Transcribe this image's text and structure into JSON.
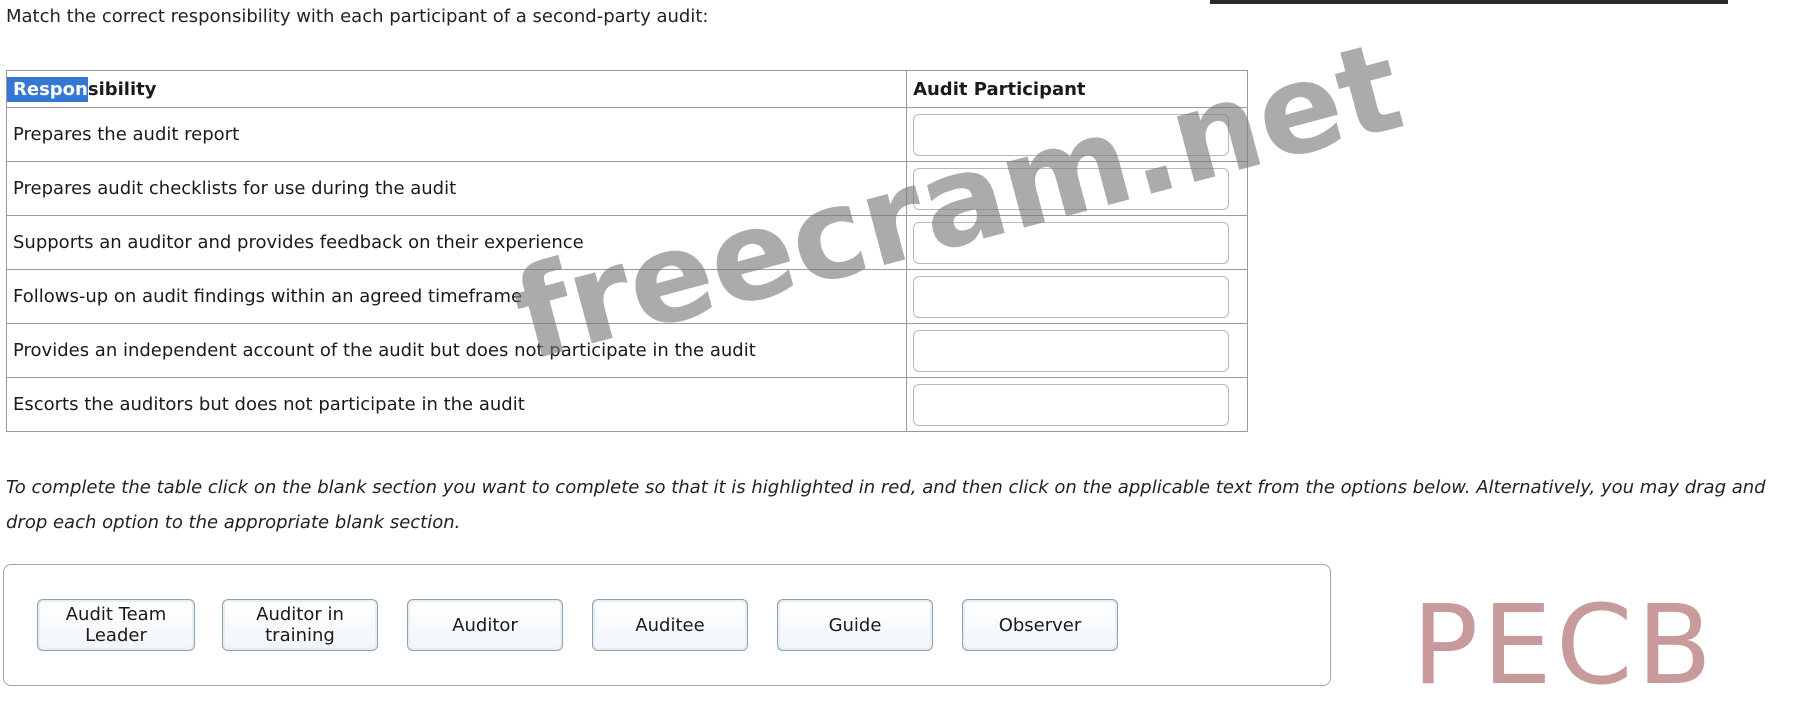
{
  "question": "Match the correct responsibility with each participant of a second-party audit:",
  "table": {
    "headers": {
      "responsibility_highlight": "Respon",
      "responsibility_rest": "sibility",
      "participant": "Audit Participant"
    },
    "rows": [
      {
        "responsibility": "Prepares the audit report",
        "participant": ""
      },
      {
        "responsibility": "Prepares audit checklists for use during the audit",
        "participant": ""
      },
      {
        "responsibility": "Supports an auditor and provides feedback on their experience",
        "participant": ""
      },
      {
        "responsibility": "Follows-up on audit findings within an agreed timeframe",
        "participant": ""
      },
      {
        "responsibility": "Provides an independent account of the audit but does not participate in the audit",
        "participant": ""
      },
      {
        "responsibility": "Escorts the auditors but does not participate in the audit",
        "participant": ""
      }
    ]
  },
  "instructions": "To complete the table click on the blank section you want to complete so that it is highlighted in red, and then click on the applicable text from the options below. Alternatively, you may drag and drop each option to the appropriate blank section.",
  "options": [
    "Audit Team Leader",
    "Auditor in training",
    "Auditor",
    "Auditee",
    "Guide",
    "Observer"
  ],
  "logo_text": "PECB",
  "watermark_text": "freecram.net",
  "colors": {
    "header_highlight": "#3478d4",
    "logo": "#c99a9b",
    "watermark": "#787878"
  }
}
